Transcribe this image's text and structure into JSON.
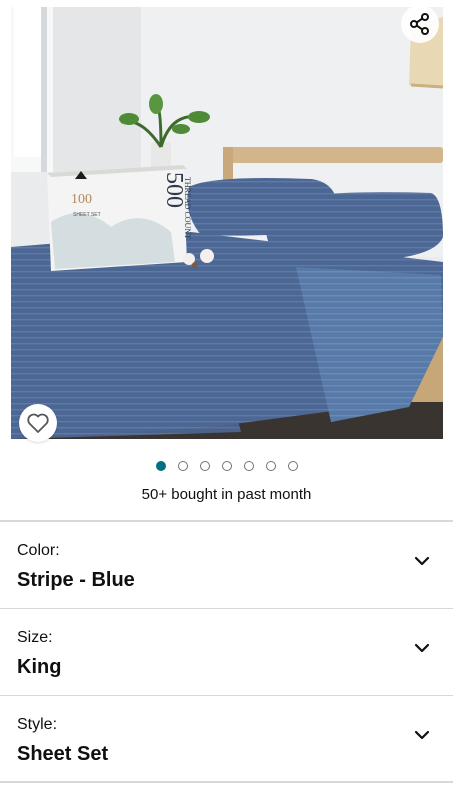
{
  "product_image": {
    "box_brand_mark": "100",
    "box_count_text": "500",
    "box_thread_text": "THREAD COUNT",
    "box_product_text": "SHEET SET"
  },
  "actions": {
    "share_icon": "share-icon",
    "favorite_icon": "heart-outline-icon"
  },
  "carousel": {
    "total": 7,
    "active_index": 0
  },
  "social_proof": {
    "bought_text": "50+ bought in past month"
  },
  "options": [
    {
      "label": "Color:",
      "value": "Stripe - Blue"
    },
    {
      "label": "Size:",
      "value": "King"
    },
    {
      "label": "Style:",
      "value": "Sheet Set"
    }
  ],
  "colors": {
    "accent": "#007185",
    "sheet_blue": "#4a6591",
    "divider": "#d5d9d9"
  }
}
